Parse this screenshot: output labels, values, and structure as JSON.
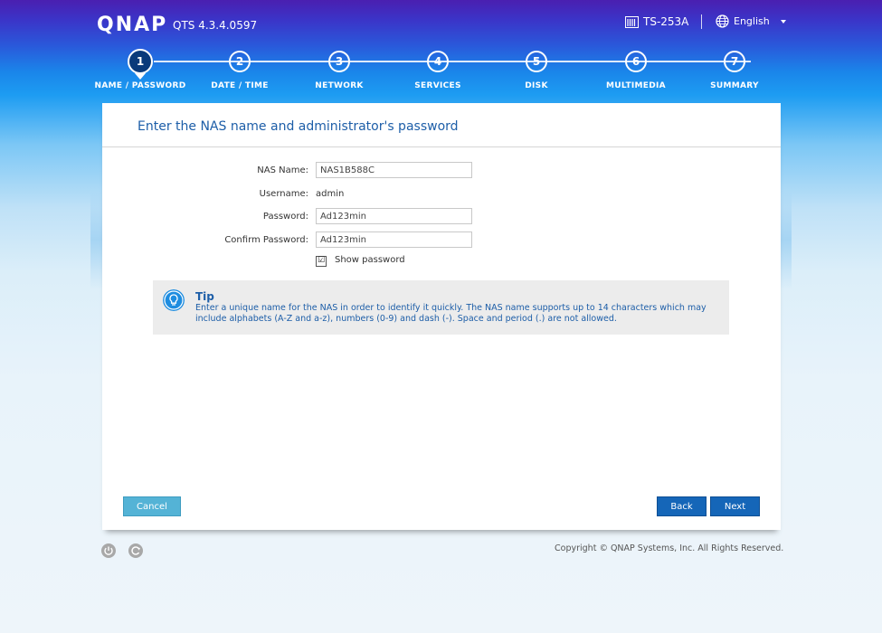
{
  "header": {
    "logo": "QNAP",
    "version": "QTS 4.3.4.0597",
    "model": "TS-253A",
    "language": "English"
  },
  "steps": [
    {
      "num": "1",
      "label": "NAME / PASSWORD",
      "active": true
    },
    {
      "num": "2",
      "label": "DATE / TIME",
      "active": false
    },
    {
      "num": "3",
      "label": "NETWORK",
      "active": false
    },
    {
      "num": "4",
      "label": "SERVICES",
      "active": false
    },
    {
      "num": "5",
      "label": "DISK",
      "active": false
    },
    {
      "num": "6",
      "label": "MULTIMEDIA",
      "active": false
    },
    {
      "num": "7",
      "label": "SUMMARY",
      "active": false
    }
  ],
  "panel": {
    "title": "Enter the NAS name and administrator's password"
  },
  "form": {
    "nas_name_label": "NAS Name:",
    "nas_name_value": "NAS1B588C",
    "username_label": "Username:",
    "username_value": "admin",
    "password_label": "Password:",
    "password_value": "Ad123min",
    "confirm_label": "Confirm Password:",
    "confirm_value": "Ad123min",
    "show_password_label": "Show password",
    "show_password_checked": "☑"
  },
  "tip": {
    "title": "Tip",
    "text": "Enter a unique name for the NAS in order to identify it quickly. The NAS name supports up to 14 characters which may include alphabets (A-Z and a-z), numbers (0-9) and dash (-). Space and period (.) are not allowed."
  },
  "buttons": {
    "cancel": "Cancel",
    "back": "Back",
    "next": "Next"
  },
  "footer": {
    "copyright": "Copyright © QNAP Systems, Inc. All Rights Reserved."
  },
  "icons": {
    "model": "nas-device-icon",
    "language": "globe-icon",
    "dropdown": "caret-down-icon",
    "tip": "lightbulb-icon",
    "power": "power-icon",
    "refresh": "refresh-icon"
  },
  "colors": {
    "accent": "#1566b8",
    "title": "#1d5ea8",
    "cancel": "#54b3d6"
  }
}
